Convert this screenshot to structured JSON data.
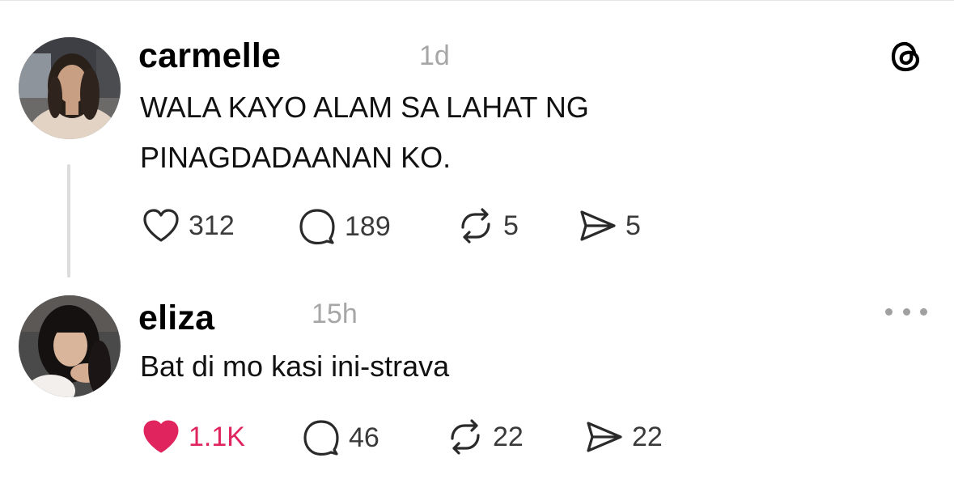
{
  "app": {
    "logo_icon": "threads-logo-icon"
  },
  "posts": [
    {
      "username": "carmelle",
      "timestamp": "1d",
      "text_lines": [
        "WALA KAYO ALAM SA LAHAT NG",
        "PINAGDADAANAN KO."
      ],
      "avatar_icon": "avatar-photo",
      "actions": {
        "likes": "312",
        "replies": "189",
        "reposts": "5",
        "shares": "5"
      },
      "liked": false
    },
    {
      "username": "eliza",
      "timestamp": "15h",
      "text_lines": [
        "Bat di mo kasi ini-strava"
      ],
      "avatar_icon": "avatar-photo",
      "actions": {
        "likes": "1.1K",
        "replies": "46",
        "reposts": "22",
        "shares": "22"
      },
      "liked": true
    }
  ],
  "colors": {
    "like_active": "#e0245e",
    "muted_text": "#a6a6a6",
    "thread_line": "#dcdcdc"
  }
}
